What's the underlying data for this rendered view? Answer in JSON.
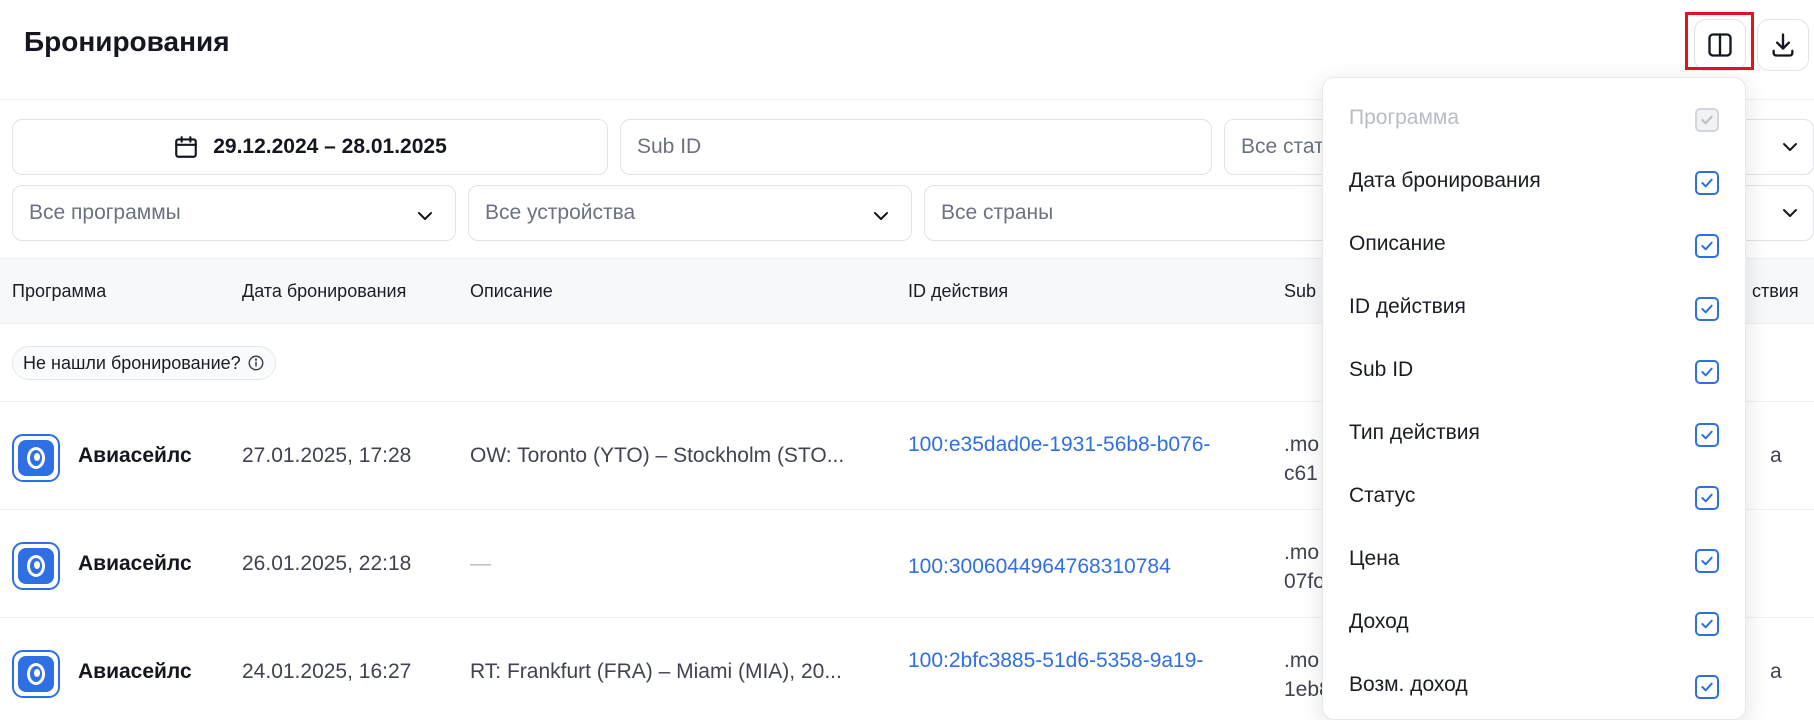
{
  "header": {
    "title": "Бронирования",
    "columns_icon": "columns-icon",
    "download_icon": "download-icon"
  },
  "filters": {
    "date_range": "29.12.2024 – 28.01.2025",
    "sub_id_placeholder": "Sub ID",
    "status_value": "Все стат",
    "programs_value": "Все программы",
    "devices_value": "Все устройства",
    "countries_value": "Все страны"
  },
  "table": {
    "columns": [
      "Программа",
      "Дата бронирования",
      "Описание",
      "ID действия",
      "Sub",
      "ствия"
    ],
    "notice": "Не нашли бронирование?",
    "rows": [
      {
        "program": "Авиасейлс",
        "date": "27.01.2025, 17:28",
        "description": "OW: Toronto (YTO) – Stockholm (STO...",
        "action_id": "100:e35dad0e-1931-56b8-b076-",
        "sub_id": ".mo c61",
        "right": "a"
      },
      {
        "program": "Авиасейлс",
        "date": "26.01.2025, 22:18",
        "description": "—",
        "action_id": "100:3006044964768310784",
        "sub_id": ".mo 07fo",
        "right": ""
      },
      {
        "program": "Авиасейлс",
        "date": "24.01.2025, 16:27",
        "description": "RT: Frankfurt (FRA) – Miami (MIA), 20...",
        "action_id": "100:2bfc3885-51d6-5358-9a19-",
        "sub_id": ".mo 1eb8",
        "right": "a"
      }
    ]
  },
  "column_menu": {
    "items": [
      {
        "label": "Программа",
        "checked": true,
        "disabled": true
      },
      {
        "label": "Дата бронирования",
        "checked": true,
        "disabled": false
      },
      {
        "label": "Описание",
        "checked": true,
        "disabled": false
      },
      {
        "label": "ID действия",
        "checked": true,
        "disabled": false
      },
      {
        "label": "Sub ID",
        "checked": true,
        "disabled": false
      },
      {
        "label": "Тип действия",
        "checked": true,
        "disabled": false
      },
      {
        "label": "Статус",
        "checked": true,
        "disabled": false
      },
      {
        "label": "Цена",
        "checked": true,
        "disabled": false
      },
      {
        "label": "Доход",
        "checked": true,
        "disabled": false
      },
      {
        "label": "Возм. доход",
        "checked": true,
        "disabled": false
      }
    ]
  },
  "colors": {
    "accent": "#2f6fe4",
    "highlight": "#e0141e",
    "text": "#1a1d24"
  }
}
